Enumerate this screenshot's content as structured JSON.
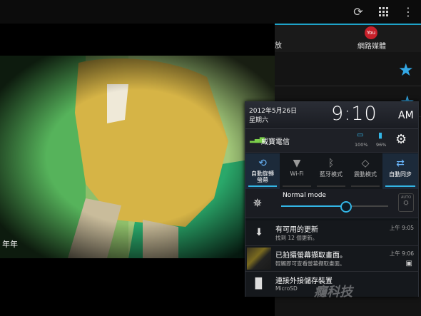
{
  "top_bar": {
    "icons": [
      "refresh-icon",
      "grid-icon",
      "overflow-menu-icon"
    ]
  },
  "app": {
    "tab_partial_label": "放",
    "tab_label": "網路媒體"
  },
  "video": {
    "caption_partial": "年年"
  },
  "status_panel": {
    "date": "2012年5月26日",
    "weekday": "星期六",
    "time": "9:10",
    "ampm": "AM",
    "carrier": "威寶電信",
    "battery_percent_1": "100%",
    "battery_percent_2": "96%",
    "toggles": [
      {
        "label": "自動旋轉\n螢幕",
        "state": "on",
        "icon": "rotate-icon"
      },
      {
        "label": "Wi-Fi",
        "state": "off",
        "icon": "wifi-icon"
      },
      {
        "label": "藍牙模式",
        "state": "off",
        "icon": "bluetooth-icon"
      },
      {
        "label": "震動模式",
        "state": "off",
        "icon": "vibrate-icon"
      },
      {
        "label": "自動同步",
        "state": "on",
        "icon": "sync-icon"
      }
    ],
    "brightness_mode": "Normal mode",
    "brightness_level": 0.6,
    "brightness_side_label": "AUTO"
  },
  "notifications": [
    {
      "title": "有可用的更新",
      "sub": "找到 12 個更新。",
      "time": "上午 9:05",
      "icon": "download-icon"
    },
    {
      "title": "已拍攝螢幕擷取畫面。",
      "sub": "輕觸即可查看螢幕擷取畫面。",
      "time": "上午 9:06",
      "icon": "screenshot-thumbnail"
    },
    {
      "title": "連接外接儲存裝置",
      "sub": "MicroSD",
      "time": "",
      "icon": "sd-card-icon"
    }
  ],
  "watermark": "癮科技",
  "colors": {
    "accent": "#33b5e5",
    "star": "#33a8e6",
    "panel_bg": "#101418"
  }
}
